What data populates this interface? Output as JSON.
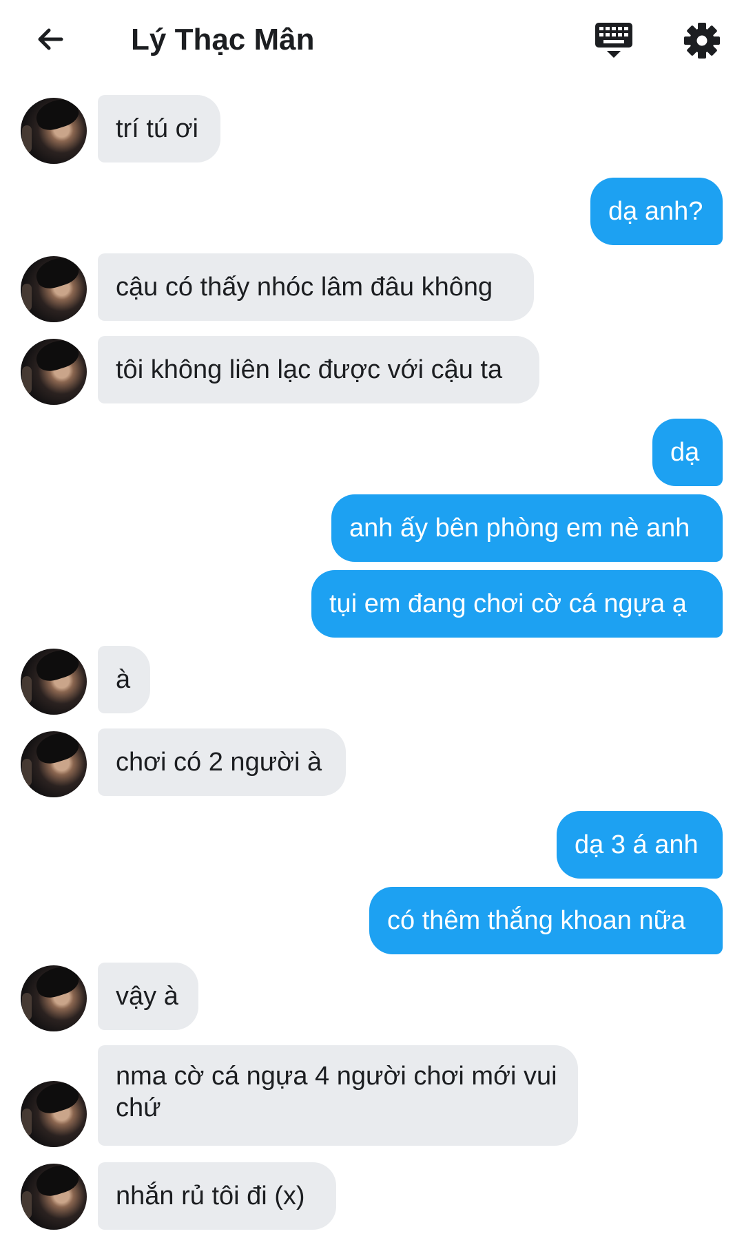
{
  "header": {
    "title": "Lý Thạc Mân",
    "back_icon": "arrow-left-icon",
    "keyboard_icon": "keyboard-icon",
    "settings_icon": "gear-icon"
  },
  "colors": {
    "outgoing_bubble": "#1da1f2",
    "incoming_bubble": "#e9ebee",
    "text_dark": "#1c1e21",
    "text_light": "#ffffff"
  },
  "messages": [
    {
      "from": "them",
      "text": "trí tú ơi"
    },
    {
      "from": "me",
      "text": "dạ anh?"
    },
    {
      "from": "them",
      "text": "cậu có thấy nhóc lâm đâu không"
    },
    {
      "from": "them",
      "text": "tôi không liên lạc được với cậu ta"
    },
    {
      "from": "me",
      "text": "dạ"
    },
    {
      "from": "me",
      "text": "anh ấy bên phòng em nè anh"
    },
    {
      "from": "me",
      "text": "tụi em đang chơi cờ cá ngựa ạ"
    },
    {
      "from": "them",
      "text": "à"
    },
    {
      "from": "them",
      "text": "chơi có 2 người à"
    },
    {
      "from": "me",
      "text": "dạ 3 á anh"
    },
    {
      "from": "me",
      "text": "có thêm thắng khoan nữa"
    },
    {
      "from": "them",
      "text": "vậy à"
    },
    {
      "from": "them",
      "text": "nma cờ cá ngựa 4 người chơi mới vui chứ"
    },
    {
      "from": "them",
      "text": "nhắn rủ tôi đi (x)"
    }
  ]
}
